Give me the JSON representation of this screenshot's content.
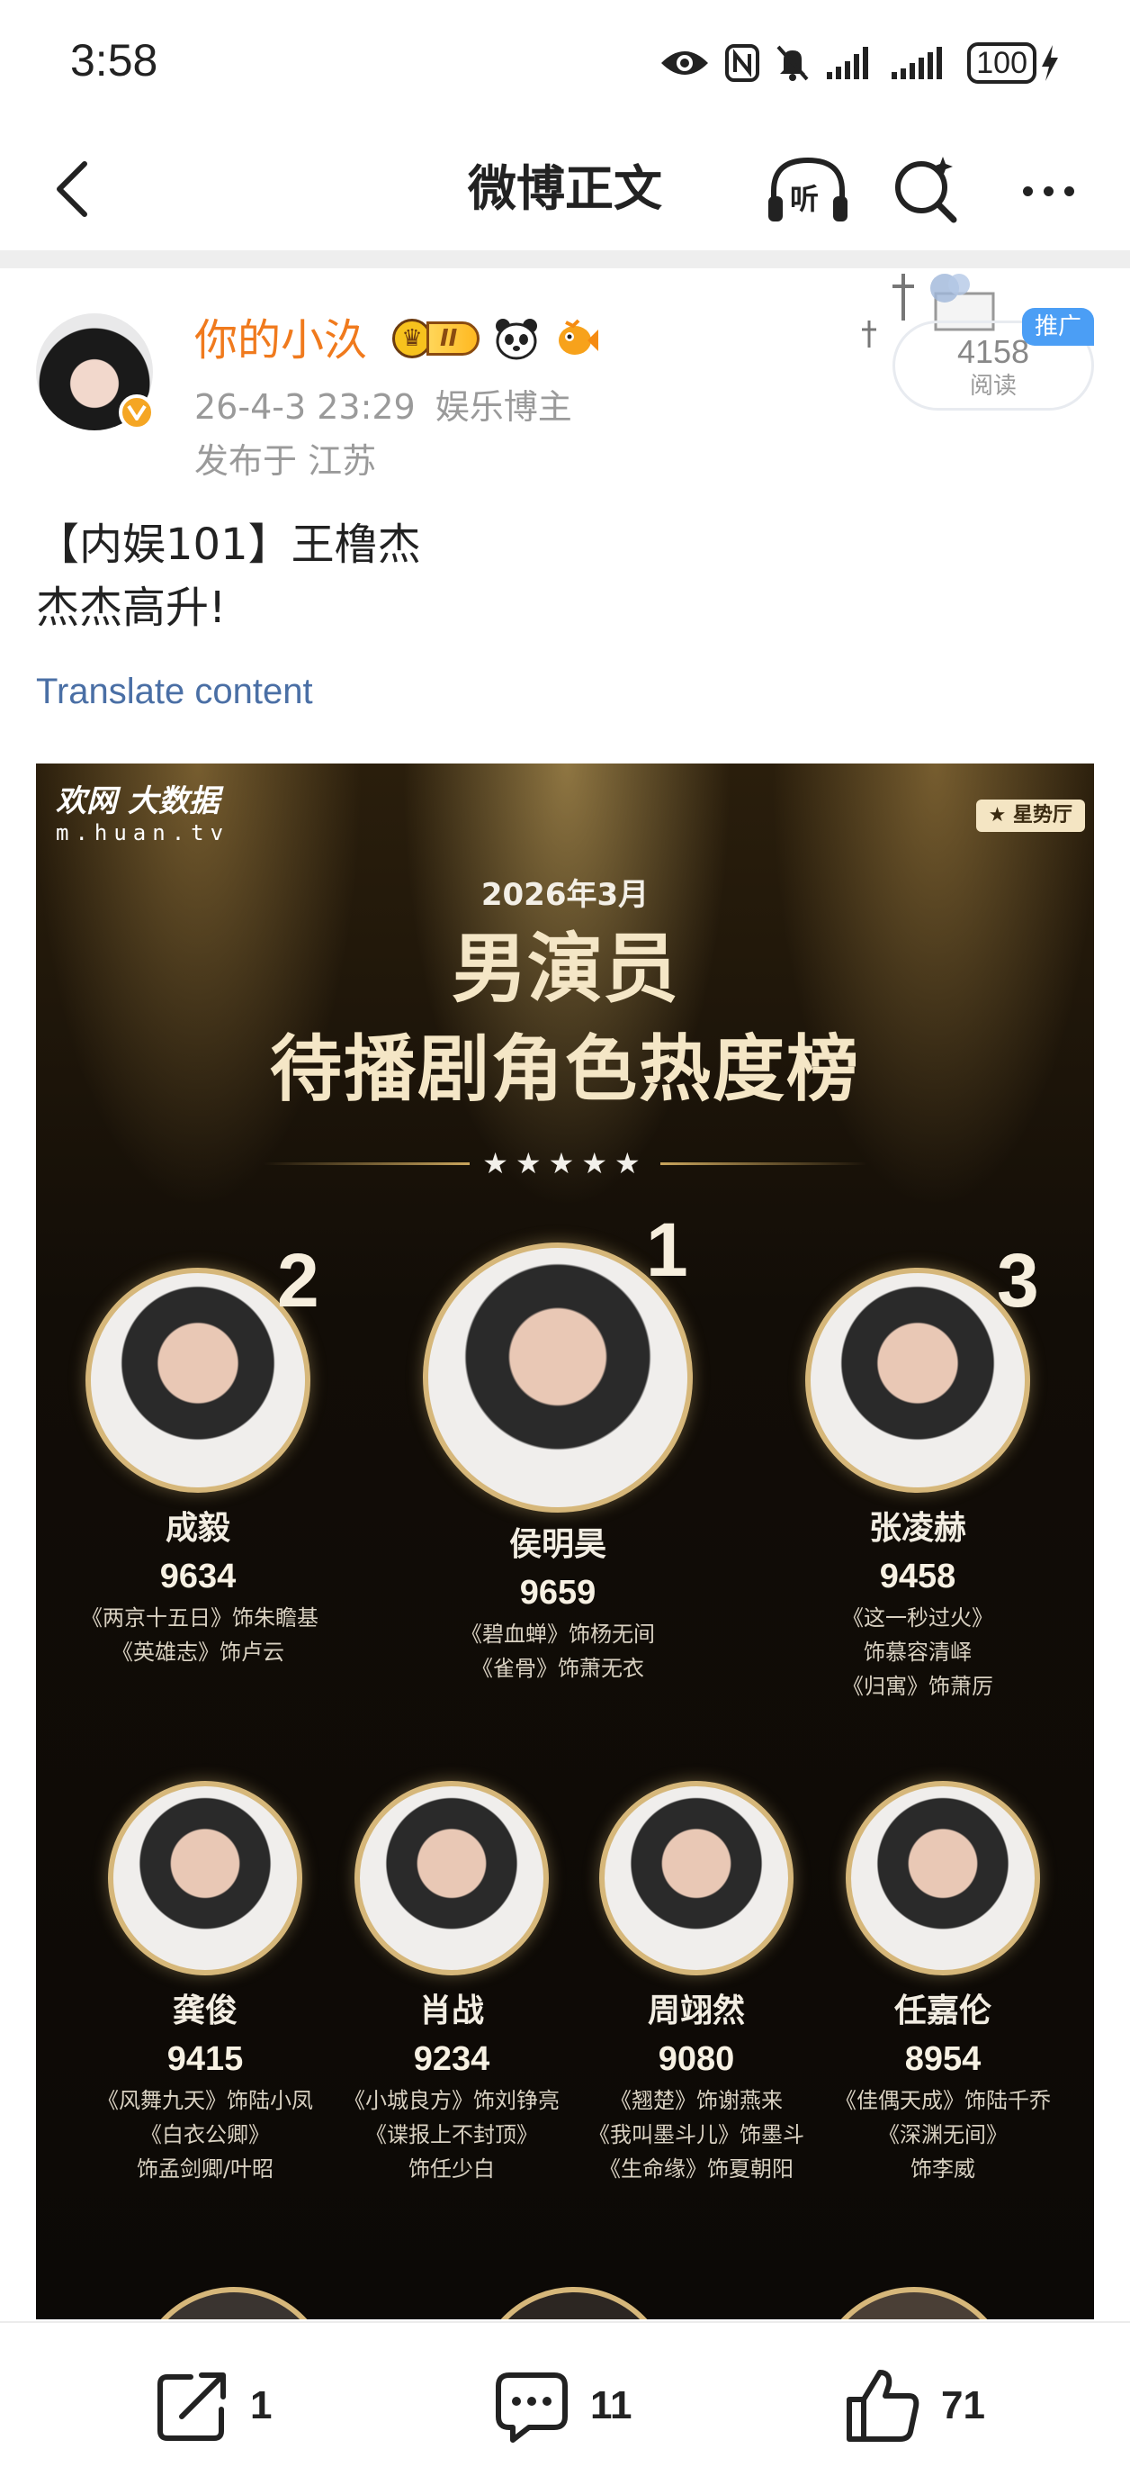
{
  "status_bar": {
    "time": "3:58",
    "battery": "100",
    "icons": [
      "eye-icon",
      "nfc-icon",
      "mute-icon",
      "signal-icon",
      "signal-icon",
      "charging-icon"
    ]
  },
  "nav": {
    "title": "微博正文",
    "listen_label": "听",
    "icons": [
      "back-arrow-icon",
      "headphones-icon",
      "search-icon",
      "more-icon"
    ]
  },
  "post": {
    "user_name": "你的小汣",
    "vip_level": "II",
    "time": "26-4-3 23:29",
    "category": "娱乐博主",
    "location": "发布于 江苏",
    "read_count": "4158",
    "read_label": "阅读",
    "promo_label": "推广",
    "text_line1": "【内娱101】王橹杰",
    "text_line2": "杰杰高升!",
    "translate_label": "Translate content"
  },
  "poster": {
    "brand_main": "欢网 大数据",
    "brand_sub": "m.huan.tv",
    "hall_tag": "★ 星势厅",
    "date": "2026年3月",
    "title_line1": "男演员",
    "title_line2": "待播剧角色热度榜",
    "stars": "★★★★★",
    "actors": [
      {
        "rank": "2",
        "name": "成毅",
        "score": "9634",
        "roles": [
          "《两京十五日》饰朱瞻基",
          "《英雄志》饰卢云"
        ]
      },
      {
        "rank": "1",
        "name": "侯明昊",
        "score": "9659",
        "roles": [
          "《碧血蝉》饰杨无间",
          "《雀骨》饰萧无衣"
        ]
      },
      {
        "rank": "3",
        "name": "张凌赫",
        "score": "9458",
        "roles": [
          "《这一秒过火》",
          "饰慕容清峄",
          "《归寓》饰萧厉"
        ]
      },
      {
        "rank": "",
        "name": "龚俊",
        "score": "9415",
        "roles": [
          "《风舞九天》饰陆小凤",
          "《白衣公卿》",
          "饰孟剑卿/叶昭"
        ]
      },
      {
        "rank": "",
        "name": "肖战",
        "score": "9234",
        "roles": [
          "《小城良方》饰刘铮亮",
          "《谍报上不封顶》",
          "饰任少白"
        ]
      },
      {
        "rank": "",
        "name": "周翊然",
        "score": "9080",
        "roles": [
          "《翘楚》饰谢燕来",
          "《我叫墨斗儿》饰墨斗",
          "《生命缘》饰夏朝阳"
        ]
      },
      {
        "rank": "",
        "name": "任嘉伦",
        "score": "8954",
        "roles": [
          "《佳偶天成》饰陆千乔",
          "《深渊无间》",
          "饰李威"
        ]
      }
    ]
  },
  "actions": {
    "share_count": "1",
    "comment_count": "11",
    "like_count": "71"
  },
  "colors": {
    "username": "#f07a1d",
    "meta": "#9a9a9a",
    "link": "#4a6fa5",
    "promo": "#4b9ef5",
    "poster_gold": "#d6b77a"
  }
}
